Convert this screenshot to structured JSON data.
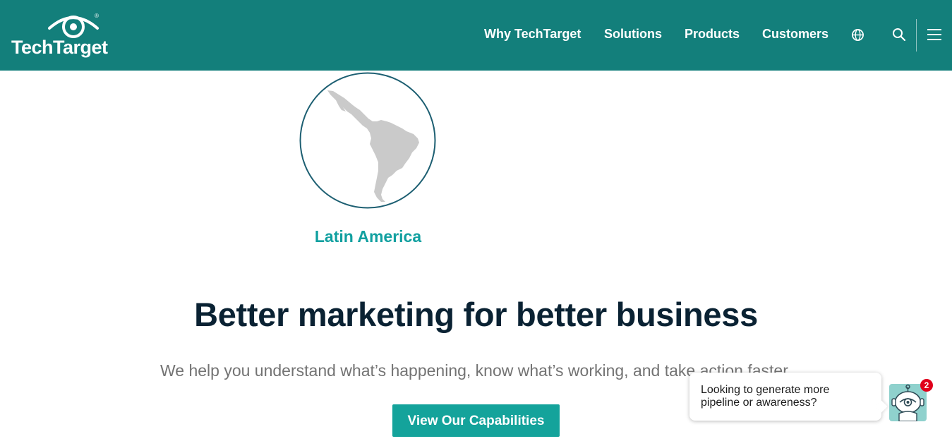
{
  "header": {
    "logo_text": "TechTarget",
    "logo_reg": "®",
    "nav": [
      "Why TechTarget",
      "Solutions",
      "Products",
      "Customers"
    ],
    "icons": [
      "globe-icon",
      "search-icon",
      "menu-icon"
    ]
  },
  "region": {
    "label": "Latin America",
    "icon": "latin-america-map-icon"
  },
  "hero": {
    "headline": "Better marketing for better business",
    "subtext": "We help you understand what’s happening, know what’s working, and take action faster.",
    "cta": "View Our Capabilities"
  },
  "chat": {
    "message_line1": "Looking to generate more",
    "message_line2": "pipeline or awareness?",
    "badge": "2",
    "icon": "chatbot-icon"
  },
  "colors": {
    "header_bg": "#137f7b",
    "accent": "#14a39b",
    "region_label": "#11a0a0",
    "headline": "#0a2233",
    "badge": "#e0001b"
  }
}
